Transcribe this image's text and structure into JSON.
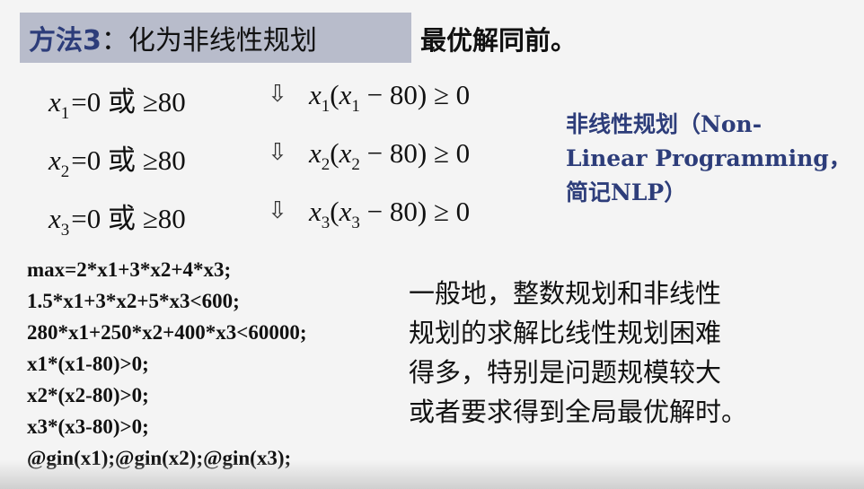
{
  "header": {
    "prefix": "方法3",
    "rest": "：化为非线性规划",
    "note": "最优解同前。"
  },
  "conditions": [
    {
      "var": "x",
      "sub": "1",
      "rest": "=0 或 ≥80"
    },
    {
      "var": "x",
      "sub": "2",
      "rest": "=0 或 ≥80"
    },
    {
      "var": "x",
      "sub": "3",
      "rest": "=0 或 ≥80"
    }
  ],
  "arrow_symbol": "⇩",
  "inequalities": [
    {
      "a": "x",
      "sub": "1",
      "open": "(",
      "b": "x",
      "sub2": "1",
      "tail": " − 80) ≥ 0"
    },
    {
      "a": "x",
      "sub": "2",
      "open": "(",
      "b": "x",
      "sub2": "2",
      "tail": " − 80) ≥ 0"
    },
    {
      "a": "x",
      "sub": "3",
      "open": "(",
      "b": "x",
      "sub2": "3",
      "tail": " − 80) ≥ 0"
    }
  ],
  "nlp_note": [
    "非线性规划（Non-",
    "Linear Programming，",
    "简记NLP）"
  ],
  "code_lines": [
    "max=2*x1+3*x2+4*x3;",
    "1.5*x1+3*x2+5*x3<600;",
    "280*x1+250*x2+400*x3<60000;",
    "x1*(x1-80)>0;",
    "x2*(x2-80)>0;",
    "x3*(x3-80)>0;",
    "@gin(x1);@gin(x2);@gin(x3);"
  ],
  "remark_lines": [
    "一般地，整数规划和非线性",
    "规划的求解比线性规划困难",
    "得多，特别是问题规模较大",
    "或者要求得到全局最优解时。"
  ]
}
